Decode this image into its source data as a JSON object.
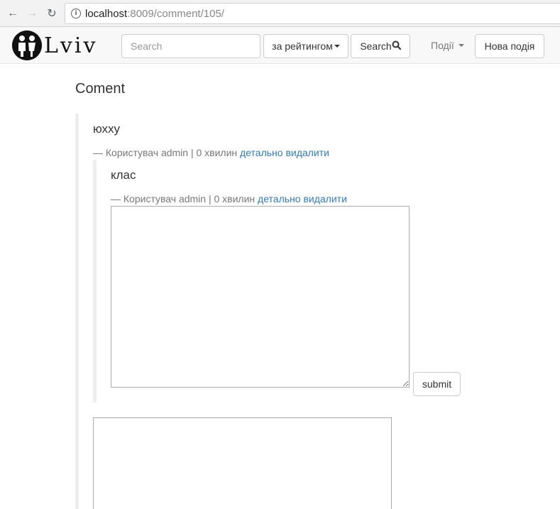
{
  "browser": {
    "url_host": "localhost",
    "url_path": ":8009/comment/105/"
  },
  "navbar": {
    "logo_text": "Lviv",
    "search_placeholder": "Search",
    "sort_label": "за рейтингом",
    "search_button": "Search",
    "events_label": "Події",
    "new_event_label": "Нова подія"
  },
  "page": {
    "title": "Coment"
  },
  "comments": [
    {
      "text": "юххy",
      "meta_prefix": "— Користувач admin | 0 хвилин",
      "detail_link": "детально",
      "delete_link": "видалити"
    },
    {
      "text": "клас",
      "meta_prefix": "— Користувач admin | 0 хвилин",
      "detail_link": "детально",
      "delete_link": "видалити"
    }
  ],
  "reply_form": {
    "submit_label": "submit",
    "value": ""
  }
}
